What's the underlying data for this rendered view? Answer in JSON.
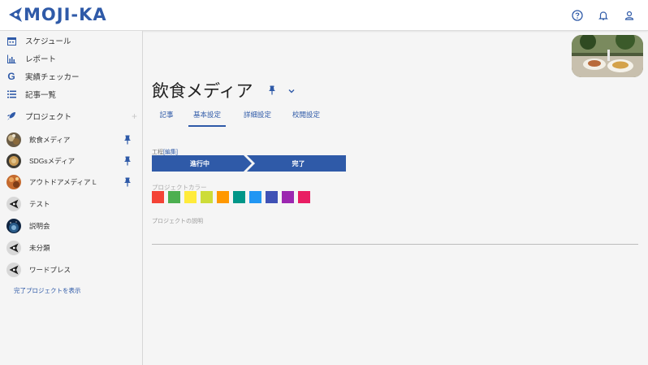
{
  "app": {
    "logo_text": "MOJI-KA",
    "brand_color": "#2f5aa8"
  },
  "header": {
    "icons": [
      "help-icon",
      "bell-icon",
      "user-icon"
    ]
  },
  "sidebar": {
    "nav": [
      {
        "label": "スケジュール",
        "icon": "calendar-icon"
      },
      {
        "label": "レポート",
        "icon": "bar-chart-icon"
      },
      {
        "label": "実績チェッカー",
        "icon": "google-g-icon"
      },
      {
        "label": "記事一覧",
        "icon": "list-icon"
      },
      {
        "label": "プロジェクト",
        "icon": "rocket-icon"
      }
    ],
    "add_label": "+",
    "projects": [
      {
        "label": "飲食メディア",
        "pinned": true
      },
      {
        "label": "SDGsメディア",
        "pinned": true
      },
      {
        "label": "アウトドアメディア L",
        "pinned": true
      },
      {
        "label": "テスト",
        "pinned": false
      },
      {
        "label": "説明会",
        "pinned": false
      },
      {
        "label": "未分類",
        "pinned": false
      },
      {
        "label": "ワードプレス",
        "pinned": false
      }
    ],
    "show_completed": "完了プロジェクトを表示"
  },
  "main": {
    "title": "飲食メディア",
    "tabs": [
      {
        "label": "記事",
        "active": false
      },
      {
        "label": "基本設定",
        "active": true
      },
      {
        "label": "詳細設定",
        "active": false
      },
      {
        "label": "校閲設定",
        "active": false
      }
    ],
    "status": {
      "label": "工程",
      "edit": "[編集]",
      "steps": [
        "進行中",
        "完了"
      ]
    },
    "color_label": "プロジェクトカラー",
    "colors": [
      "#f44336",
      "#4caf50",
      "#ffeb3b",
      "#cddc39",
      "#ff9800",
      "#009688",
      "#2196f3",
      "#3f51b5",
      "#9c27b0",
      "#e91e63"
    ],
    "description_label": "プロジェクトの説明"
  }
}
